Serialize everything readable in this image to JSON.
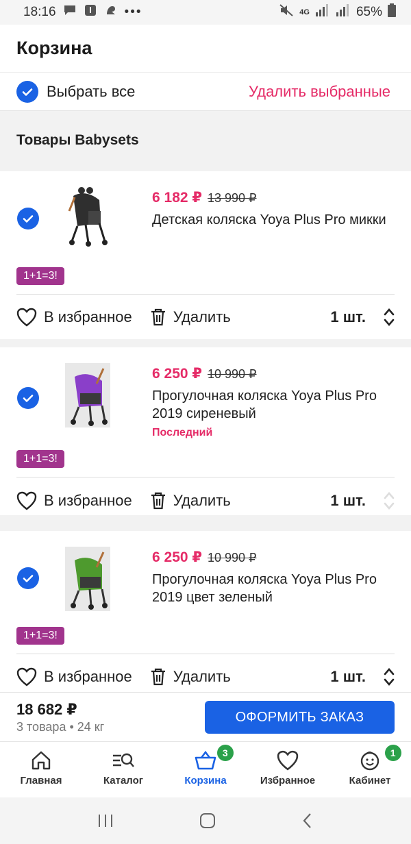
{
  "status_bar": {
    "time": "18:16",
    "network": "4G",
    "battery": "65%"
  },
  "header": {
    "title": "Корзина"
  },
  "select_all": {
    "label": "Выбрать все",
    "delete_selected": "Удалить выбранные"
  },
  "section": {
    "title": "Товары Babysets"
  },
  "items": [
    {
      "price": "6 182 ₽",
      "old_price": "13 990 ₽",
      "title": "Детская коляска Yoya Plus Pro микки",
      "tag": "",
      "promo": "1+1=3!",
      "fav": "В избранное",
      "delete": "Удалить",
      "qty": "1 шт.",
      "color": "#2f2f2f"
    },
    {
      "price": "6 250 ₽",
      "old_price": "10 990 ₽",
      "title": "Прогулочная коляска Yoya Plus Pro 2019 сиреневый",
      "tag": "Последний",
      "promo": "1+1=3!",
      "fav": "В избранное",
      "delete": "Удалить",
      "qty": "1 шт.",
      "color": "#8a3fc9"
    },
    {
      "price": "6 250 ₽",
      "old_price": "10 990 ₽",
      "title": "Прогулочная коляска Yoya Plus Pro 2019 цвет зеленый",
      "tag": "",
      "promo": "1+1=3!",
      "fav": "В избранное",
      "delete": "Удалить",
      "qty": "1 шт.",
      "color": "#4e9a2e"
    }
  ],
  "summary": {
    "total": "18 682 ₽",
    "meta": "3 товара • 24 кг",
    "order_button": "ОФОРМИТЬ ЗАКАЗ"
  },
  "tabs": [
    {
      "label": "Главная",
      "icon": "home-icon",
      "badge": ""
    },
    {
      "label": "Каталог",
      "icon": "catalog-search-icon",
      "badge": ""
    },
    {
      "label": "Корзина",
      "icon": "basket-icon",
      "badge": "3"
    },
    {
      "label": "Избранное",
      "icon": "heart-icon",
      "badge": ""
    },
    {
      "label": "Кабинет",
      "icon": "smiley-face-icon",
      "badge": "1"
    }
  ],
  "colors": {
    "accent": "#1a62e4",
    "danger": "#e52b67",
    "promo": "#a1348d",
    "badge": "#2ba14a"
  }
}
